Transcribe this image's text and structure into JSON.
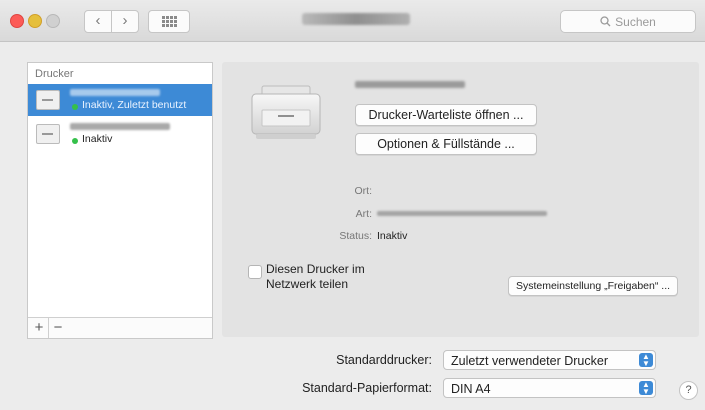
{
  "titlebar": {
    "back_glyph": "‹",
    "forward_glyph": "›",
    "search_placeholder": "Suchen"
  },
  "sidebar": {
    "header": "Drucker",
    "printers": [
      {
        "status": "Inaktiv, Zuletzt benutzt",
        "selected": true,
        "status_color": "#35c04a"
      },
      {
        "status": "Inaktiv",
        "selected": false,
        "status_color": "#35c04a"
      }
    ],
    "add_label": "+",
    "remove_label": "−"
  },
  "detail": {
    "queue_button": "Drucker-Warteliste öffnen ...",
    "options_button": "Optionen & Füllstände ...",
    "location_label": "Ort:",
    "kind_label": "Art:",
    "status_label": "Status:",
    "status_value": "Inaktiv",
    "share_label": "Diesen Drucker im Netzwerk teilen",
    "share_checked": false,
    "sharing_prefs_button": "Systemeinstellung „Freigaben“ ..."
  },
  "defaults": {
    "default_printer_label": "Standarddrucker:",
    "default_printer_value": "Zuletzt verwendeter Drucker",
    "paper_label": "Standard-Papierformat:",
    "paper_value": "DIN A4"
  },
  "help_label": "?",
  "colors": {
    "accent": "#3d8ad6",
    "close": "#fc5b57",
    "minimize": "#e5bf3c"
  }
}
